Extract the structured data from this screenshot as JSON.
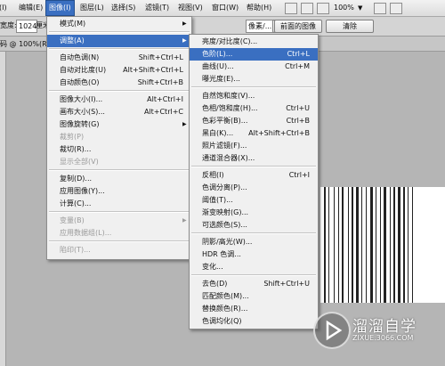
{
  "menubar": {
    "items": [
      "(I)",
      "编辑(E)",
      "图像(I)",
      "图层(L)",
      "选择(S)",
      "滤镜(T)",
      "视图(V)",
      "窗口(W)",
      "帮助(H)"
    ],
    "active_index": 2,
    "zoom": "100%"
  },
  "options": {
    "width_label": "宽度:",
    "width_value": "1024",
    "width_unit": "厘米",
    "res_unit": "像素/...",
    "front_image_button": "前面的图像",
    "clear_button": "清除"
  },
  "doc_tab": {
    "title": "码 @ 100%(RG"
  },
  "image_menu": {
    "items": [
      {
        "label": "模式(M)",
        "shortcut": "",
        "submenu": true,
        "state": "normal"
      },
      {
        "label": "调整(A)",
        "shortcut": "",
        "submenu": true,
        "state": "highlight"
      },
      {
        "label": "自动色调(N)",
        "shortcut": "Shift+Ctrl+L",
        "state": "normal"
      },
      {
        "label": "自动对比度(U)",
        "shortcut": "Alt+Shift+Ctrl+L",
        "state": "normal"
      },
      {
        "label": "自动颜色(O)",
        "shortcut": "Shift+Ctrl+B",
        "state": "normal"
      },
      {
        "label": "图像大小(I)...",
        "shortcut": "Alt+Ctrl+I",
        "state": "normal"
      },
      {
        "label": "画布大小(S)...",
        "shortcut": "Alt+Ctrl+C",
        "state": "normal"
      },
      {
        "label": "图像旋转(G)",
        "shortcut": "",
        "submenu": true,
        "state": "normal"
      },
      {
        "label": "裁剪(P)",
        "shortcut": "",
        "state": "disabled"
      },
      {
        "label": "裁切(R)...",
        "shortcut": "",
        "state": "normal"
      },
      {
        "label": "显示全部(V)",
        "shortcut": "",
        "state": "disabled"
      },
      {
        "label": "复制(D)...",
        "shortcut": "",
        "state": "normal"
      },
      {
        "label": "应用图像(Y)...",
        "shortcut": "",
        "state": "normal"
      },
      {
        "label": "计算(C)...",
        "shortcut": "",
        "state": "normal"
      },
      {
        "label": "变量(B)",
        "shortcut": "",
        "submenu": true,
        "state": "disabled"
      },
      {
        "label": "应用数据组(L)...",
        "shortcut": "",
        "state": "disabled"
      },
      {
        "label": "陷印(T)...",
        "shortcut": "",
        "state": "disabled"
      }
    ]
  },
  "adjust_menu": {
    "items": [
      {
        "label": "亮度/对比度(C)...",
        "shortcut": "",
        "state": "normal"
      },
      {
        "label": "色阶(L)...",
        "shortcut": "Ctrl+L",
        "state": "highlight"
      },
      {
        "label": "曲线(U)...",
        "shortcut": "Ctrl+M",
        "state": "normal"
      },
      {
        "label": "曝光度(E)...",
        "shortcut": "",
        "state": "normal"
      },
      {
        "label": "自然饱和度(V)...",
        "shortcut": "",
        "state": "normal"
      },
      {
        "label": "色相/饱和度(H)...",
        "shortcut": "Ctrl+U",
        "state": "normal"
      },
      {
        "label": "色彩平衡(B)...",
        "shortcut": "Ctrl+B",
        "state": "normal"
      },
      {
        "label": "黑白(K)...",
        "shortcut": "Alt+Shift+Ctrl+B",
        "state": "normal"
      },
      {
        "label": "照片滤镜(F)...",
        "shortcut": "",
        "state": "normal"
      },
      {
        "label": "通道混合器(X)...",
        "shortcut": "",
        "state": "normal"
      },
      {
        "label": "反相(I)",
        "shortcut": "Ctrl+I",
        "state": "normal"
      },
      {
        "label": "色调分离(P)...",
        "shortcut": "",
        "state": "normal"
      },
      {
        "label": "阈值(T)...",
        "shortcut": "",
        "state": "normal"
      },
      {
        "label": "渐变映射(G)...",
        "shortcut": "",
        "state": "normal"
      },
      {
        "label": "可选颜色(S)...",
        "shortcut": "",
        "state": "normal"
      },
      {
        "label": "阴影/高光(W)...",
        "shortcut": "",
        "state": "normal"
      },
      {
        "label": "HDR 色调...",
        "shortcut": "",
        "state": "normal"
      },
      {
        "label": "变化...",
        "shortcut": "",
        "state": "normal"
      },
      {
        "label": "去色(D)",
        "shortcut": "Shift+Ctrl+U",
        "state": "normal"
      },
      {
        "label": "匹配颜色(M)...",
        "shortcut": "",
        "state": "normal"
      },
      {
        "label": "替换颜色(R)...",
        "shortcut": "",
        "state": "normal"
      },
      {
        "label": "色调均化(Q)",
        "shortcut": "",
        "state": "normal"
      }
    ]
  },
  "watermark": {
    "title": "溜溜自学",
    "subtitle": "ZIXUE.3066.COM"
  },
  "colors": {
    "highlight": "#3a6fc1",
    "menu_bg": "#f0f0f0",
    "workspace": "#b5b5b5"
  }
}
